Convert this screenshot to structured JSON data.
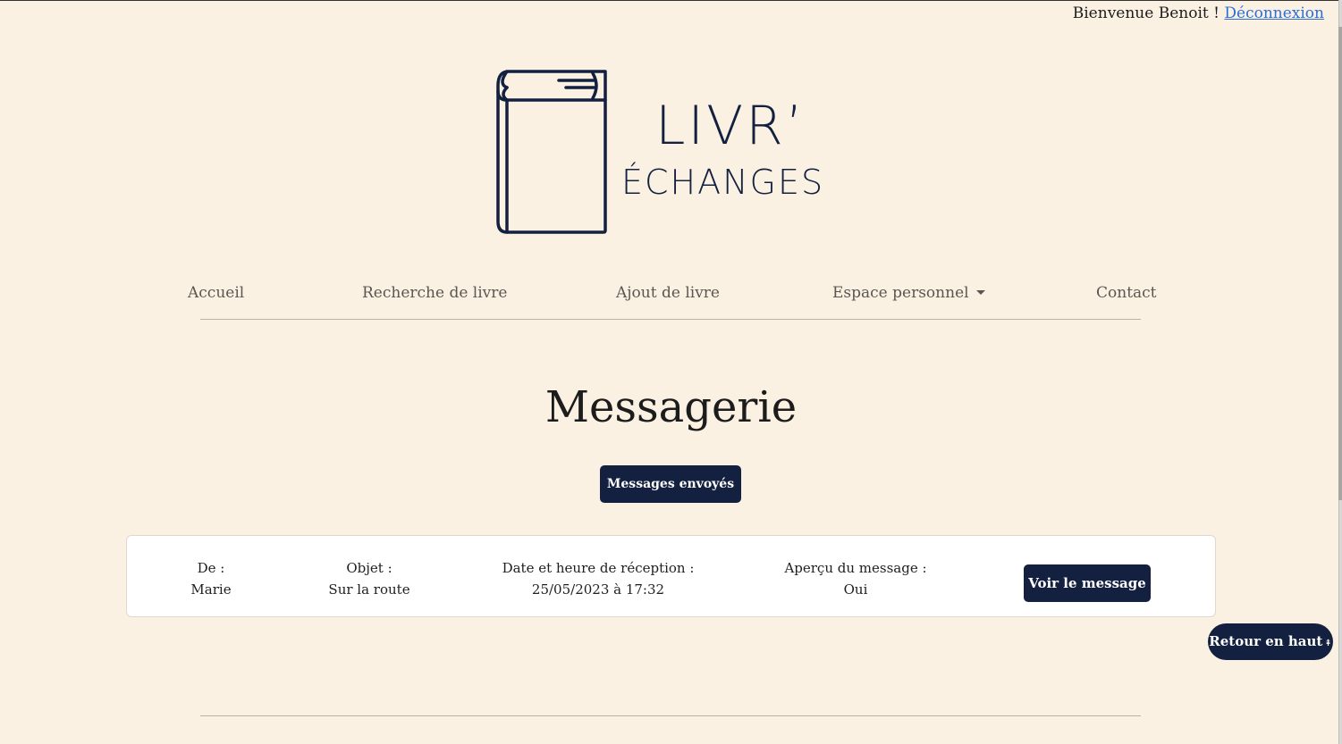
{
  "header": {
    "welcome_text": "Bienvenue Benoit !",
    "logout_label": "Déconnexion"
  },
  "logo": {
    "line1": "LIVR’",
    "line2": "ÉCHANGES",
    "icon": "book-icon"
  },
  "nav": {
    "items": [
      {
        "label": "Accueil"
      },
      {
        "label": "Recherche de livre"
      },
      {
        "label": "Ajout de livre"
      },
      {
        "label": "Espace personnel"
      },
      {
        "label": "Contact"
      }
    ]
  },
  "main": {
    "title": "Messagerie",
    "sent_button": "Messages envoyés",
    "message": {
      "from_label": "De :",
      "from_value": "Marie",
      "subject_label": "Objet :",
      "subject_value": "Sur la route",
      "date_label": "Date et heure de réception :",
      "date_value": "25/05/2023 à 17:32",
      "preview_label": "Aperçu du message :",
      "preview_value": "Oui",
      "view_button": "Voir le message"
    }
  },
  "back_to_top": {
    "label": "Retour en haut",
    "icon": "double-chevron-up-icon"
  },
  "colors": {
    "background": "#faf1e3",
    "primary": "#13203f",
    "link": "#2b6fd6"
  }
}
